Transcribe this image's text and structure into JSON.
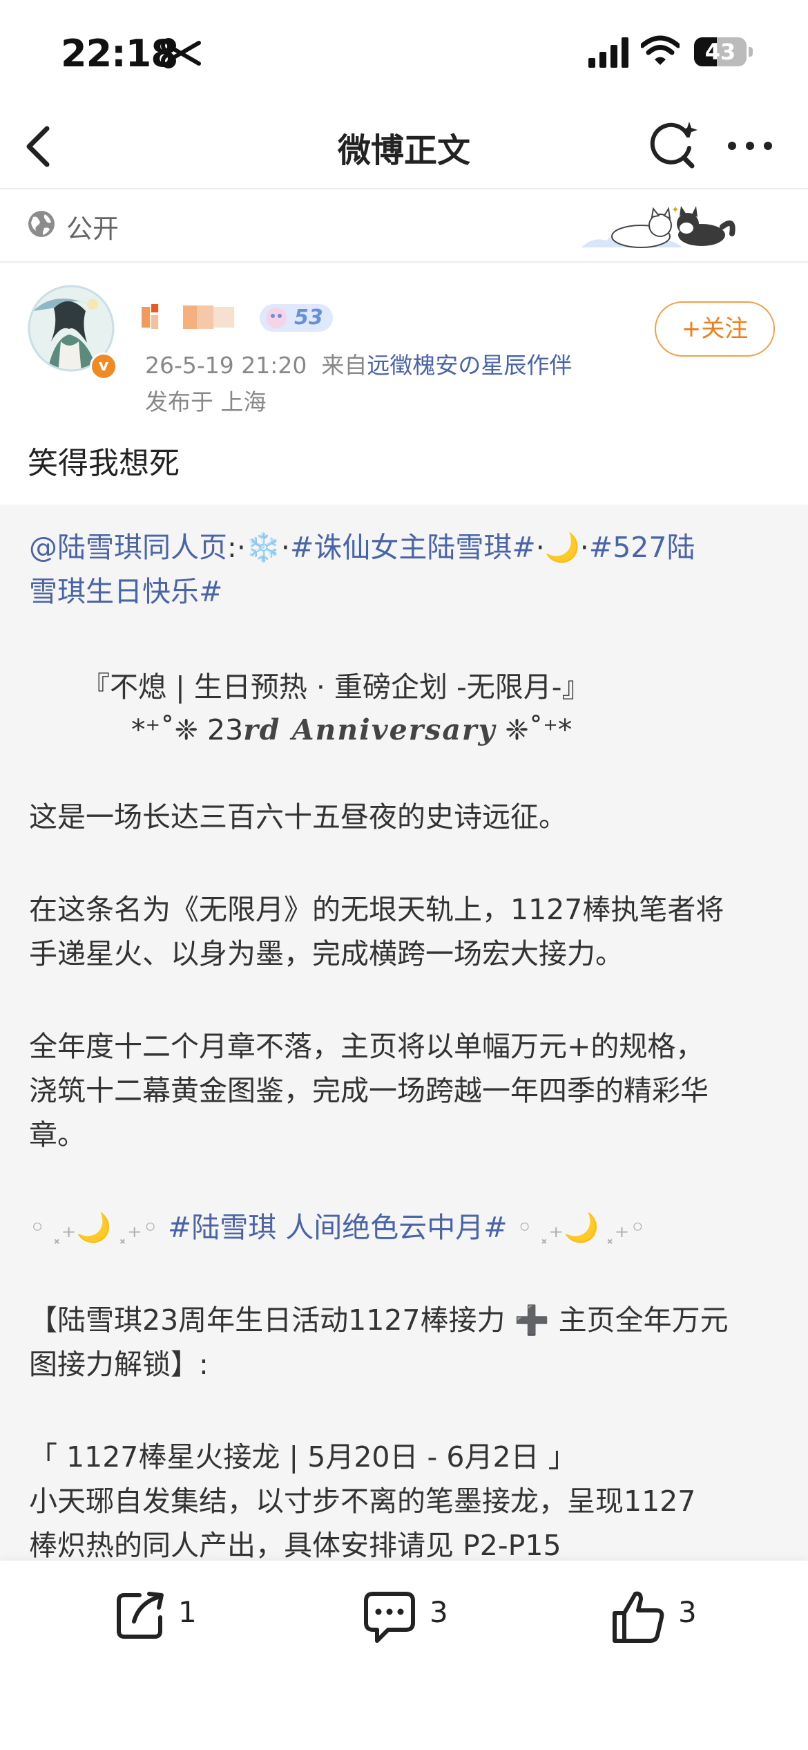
{
  "status_bar": {
    "time": "22:18",
    "battery": "43",
    "battery_level": 0.43
  },
  "nav": {
    "title": "微博正文"
  },
  "visibility": {
    "label": "公开"
  },
  "author": {
    "level": "53",
    "date": "26-5-19 21:20",
    "source_prefix": "来自",
    "source": "远徵槐安の星辰作伴",
    "location": "发布于 上海",
    "follow_label": "+关注"
  },
  "post": {
    "text": "笑得我想死"
  },
  "repost": {
    "line1": {
      "mention": "@陆雪琪同人页",
      "mid1": ":·",
      "tag1": "#诛仙女主陆雪琪#",
      "tag2": "#527陆"
    },
    "line2": "雪琪生日快乐#",
    "title": "『不熄 | 生日预热 · 重磅企划 -无限月-』",
    "anniversary_prefix": "*⁺˚❈ 23",
    "anniversary_main": "rd Anniversary",
    "anniversary_suffix": "❈˚⁺*",
    "para1": "这是一场长达三百六十五昼夜的史诗远征。",
    "para2_l1": "在这条名为《无限月》的无垠天轨上，1127棒执笔者将",
    "para2_l2": "手递星火、以身为墨，完成横跨一场宏大接力。",
    "para3_l1": "全年度十二个月章不落，主页将以单幅万元+的规格，",
    "para3_l2": "浇筑十二幕黄金图鉴，完成一场跨越一年四季的精彩华",
    "para3_l3": "章。",
    "tag_line": {
      "deco": "◦ ⸼₊🌙 ⸼₊◦",
      "tag": "#陆雪琪 人间绝色云中月#"
    },
    "event_l1": "【陆雪琪23周年生日活动1127棒接力 ➕ 主页全年万元",
    "event_l2": "图接力解锁】:",
    "relay_title": "「 1127棒星火接龙  |  5月20日 - 6月2日 」",
    "relay_l1": "小天琊自发集结，以寸步不离的笔墨接龙，呈现1127",
    "relay_l2": "棒炽热的同人产出，具体安排请见 P2-P15"
  },
  "actions": {
    "repost_count": "1",
    "comment_count": "3",
    "like_count": "3"
  },
  "colors": {
    "link": "#4a64a8",
    "follow": "#f07e1a",
    "repost_bg": "#f5f5f5"
  }
}
